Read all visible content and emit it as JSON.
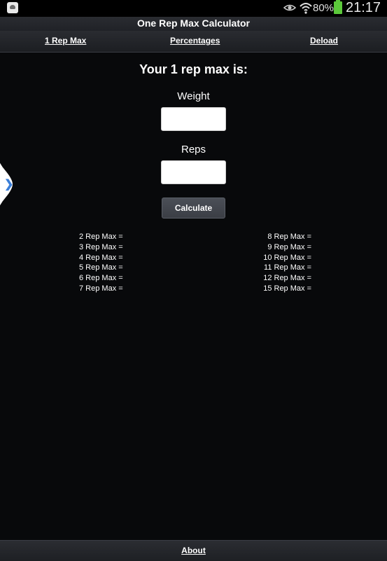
{
  "status_bar": {
    "battery_percent": "80%",
    "time": "21:17",
    "battery_color": "#5cc93b",
    "icons": [
      "app-notification-icon",
      "eye-icon",
      "wifi-icon",
      "battery-icon"
    ]
  },
  "header": {
    "title": "One Rep Max Calculator",
    "nav": [
      "1 Rep Max",
      "Percentages",
      "Deload"
    ]
  },
  "main": {
    "heading": "Your 1 rep max is:",
    "weight_label": "Weight",
    "weight_value": "",
    "reps_label": "Reps",
    "reps_value": "",
    "calculate_label": "Calculate",
    "results_left": [
      "2 Rep Max =",
      "3 Rep Max =",
      "4 Rep Max =",
      "5 Rep Max =",
      "6 Rep Max =",
      "7 Rep Max ="
    ],
    "results_right": [
      "8 Rep Max =",
      "9 Rep Max =",
      "10 Rep Max =",
      "11 Rep Max =",
      "12 Rep Max =",
      "15 Rep Max ="
    ]
  },
  "side_panel": {
    "handle_icon": "chevron-right-icon",
    "accent_color": "#3b7fd8"
  },
  "footer": {
    "about_label": "About"
  }
}
